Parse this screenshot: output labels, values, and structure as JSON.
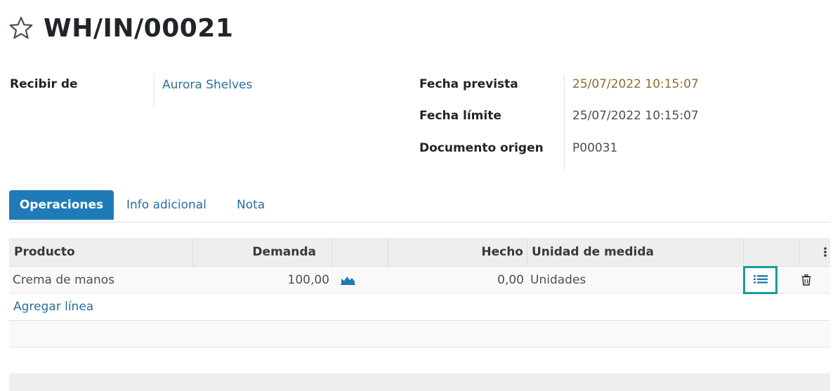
{
  "header": {
    "title": "WH/IN/00021",
    "favorite_icon": "star-outline-icon"
  },
  "form": {
    "left": {
      "receive_from_label": "Recibir de",
      "receive_from_value": "Aurora Shelves"
    },
    "right": {
      "scheduled_date_label": "Fecha prevista",
      "scheduled_date_value": "25/07/2022 10:15:07",
      "deadline_label": "Fecha límite",
      "deadline_value": "25/07/2022 10:15:07",
      "source_document_label": "Documento origen",
      "source_document_value": "P00031"
    }
  },
  "tabs": [
    {
      "label": "Operaciones",
      "active": true
    },
    {
      "label": "Info adicional",
      "active": false
    },
    {
      "label": "Nota",
      "active": false
    }
  ],
  "table": {
    "columns": {
      "product": "Producto",
      "demand": "Demanda",
      "done": "Hecho",
      "uom": "Unidad de medida"
    },
    "rows": [
      {
        "product": "Crema de manos",
        "demand": "100,00",
        "done": "0,00",
        "uom": "Unidades"
      }
    ],
    "add_line_label": "Agregar línea"
  },
  "icons": {
    "forecast": "area-chart-icon",
    "details": "list-icon",
    "delete": "trash-icon",
    "column_options": "kebab-menu-icon"
  },
  "colors": {
    "accent": "#1f7bb8",
    "link": "#2b6f9e",
    "warning_date": "#8a6d2f",
    "highlight_border": "#1a9c97"
  }
}
